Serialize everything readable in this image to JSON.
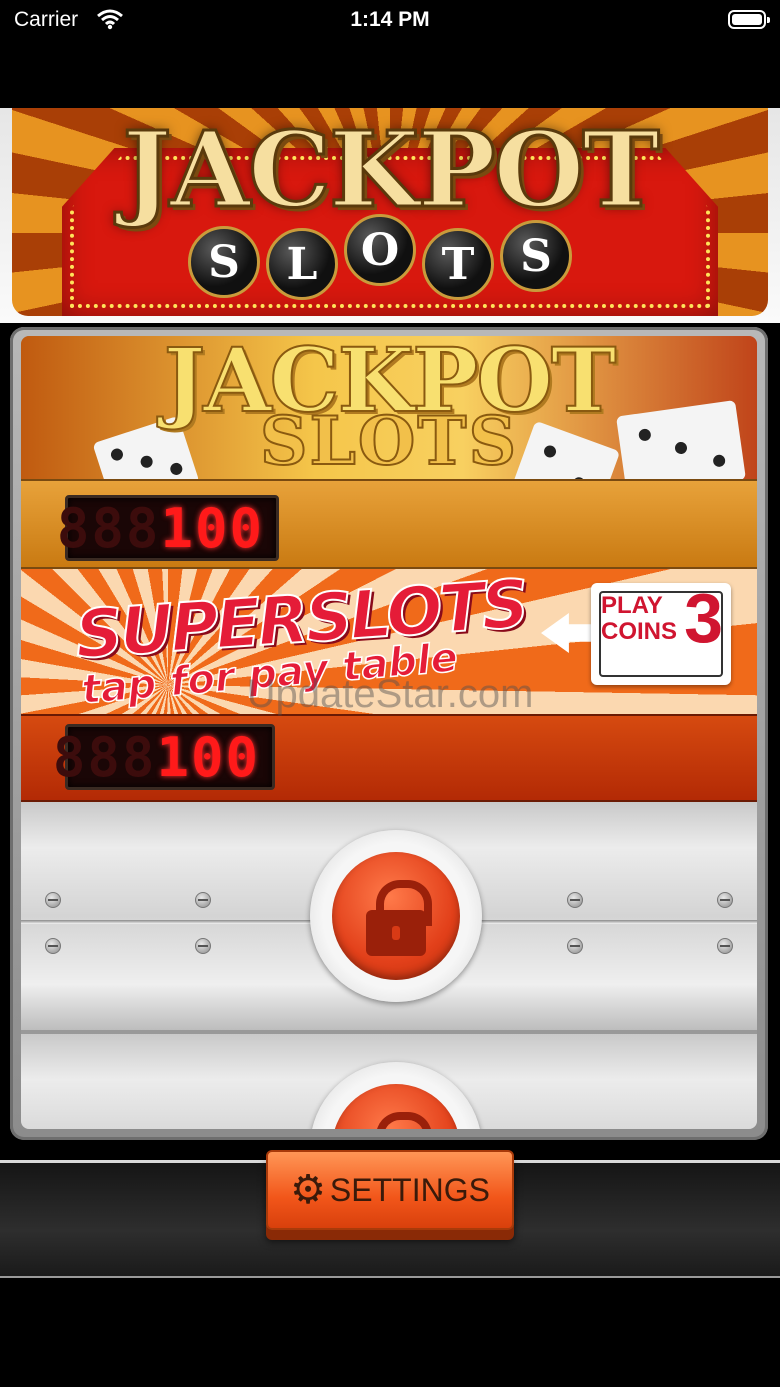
{
  "status_bar": {
    "carrier": "Carrier",
    "time": "1:14 PM"
  },
  "banner": {
    "title": "JACKPOT",
    "letters": [
      "S",
      "L",
      "O",
      "T",
      "S"
    ]
  },
  "mini_banner": {
    "title": "JACKPOT",
    "subtitle": "SLOTS"
  },
  "credits": {
    "ghost": "888",
    "value": "100"
  },
  "promo": {
    "title": "SUPERSLOTS",
    "subtitle": "tap for pay table",
    "play_label_1": "PLAY",
    "play_label_2": "COINS",
    "play_count": "3"
  },
  "bet": {
    "ghost": "888",
    "value": "100"
  },
  "watermark": "UpdateStar.com",
  "settings": {
    "icon": "gear-icon",
    "label": "SETTINGS"
  },
  "colors": {
    "accent": "#f2561a",
    "led": "#ff1a1a",
    "banner_red": "#d8180e"
  }
}
